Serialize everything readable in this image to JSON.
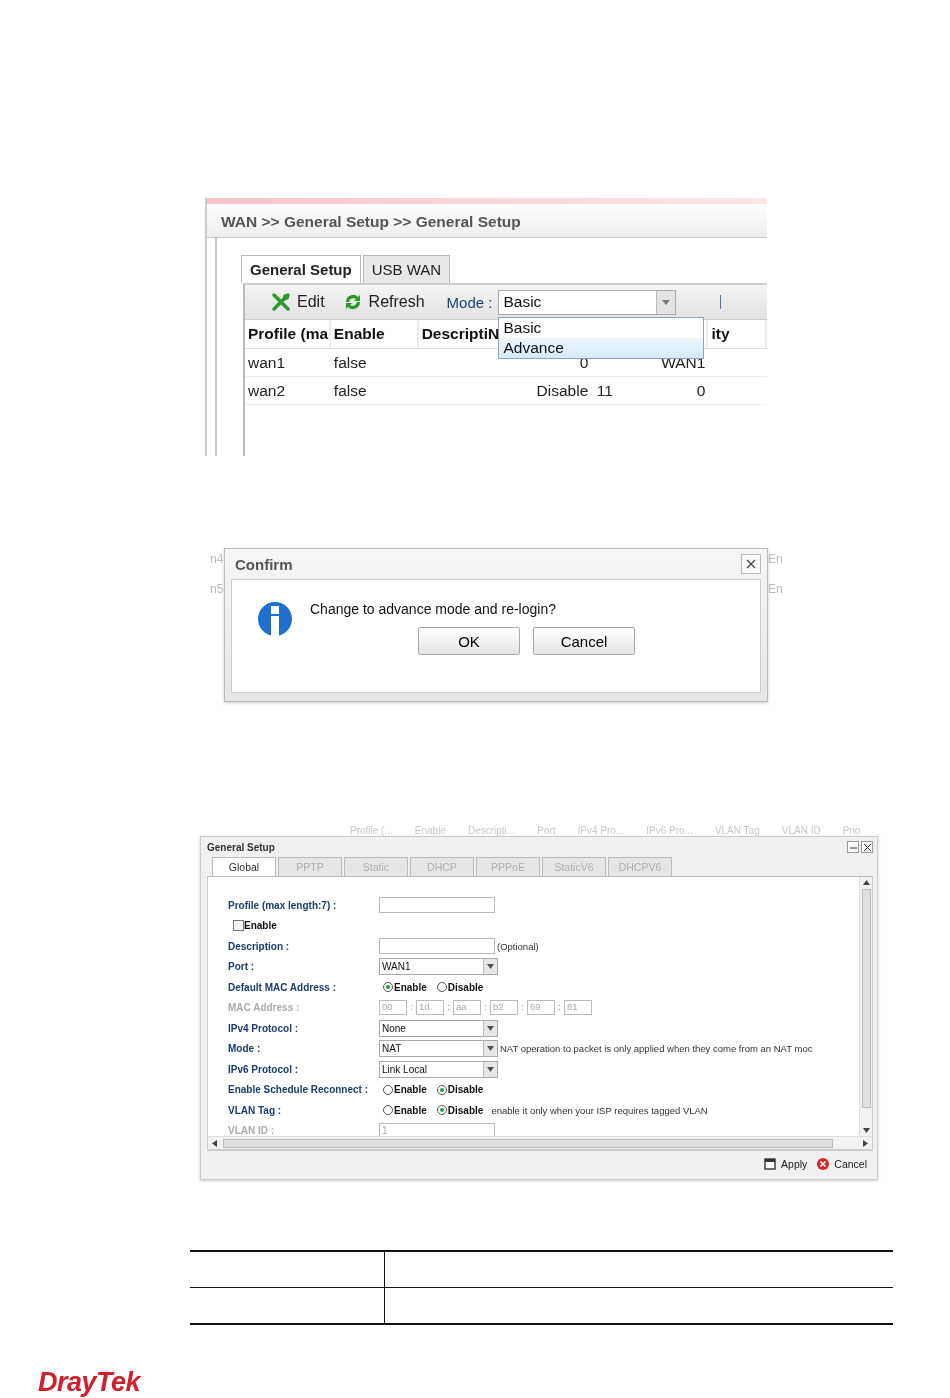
{
  "wan_general_setup": {
    "breadcrumb": "WAN >> General Setup >> General Setup",
    "tabs": [
      {
        "label": "General Setup",
        "selected": true
      },
      {
        "label": "USB WAN",
        "selected": false
      }
    ],
    "toolbar": {
      "edit": "Edit",
      "refresh": "Refresh",
      "mode_label": "Mode :",
      "mode_value": "Basic"
    },
    "mode_options": [
      {
        "label": "Basic",
        "selected": false
      },
      {
        "label": "Advance",
        "selected": true
      }
    ],
    "table": {
      "columns": [
        "Profile (ma",
        "Enable",
        "DescriptiN",
        "",
        "",
        "",
        "ity"
      ],
      "rows": [
        [
          "wan1",
          "false",
          "",
          "0",
          "",
          "WAN1",
          ""
        ],
        [
          "wan2",
          "false",
          "",
          "Disable",
          "11",
          "0",
          ""
        ]
      ]
    }
  },
  "confirm_dialog": {
    "background_left": [
      "n4",
      "n5"
    ],
    "background_right": [
      "En",
      "En"
    ],
    "title": "Confirm",
    "message": "Change to advance mode and re-login?",
    "buttons": [
      "OK",
      "Cancel"
    ]
  },
  "general_setup_window": {
    "background_columns": [
      "Profile (...",
      "Enable",
      "Descripti...",
      "Port",
      "IPv4 Pro...",
      "IPv6 Pro...",
      "VLAN Tag",
      "VLAN ID",
      "Prio"
    ],
    "title": "General Setup",
    "tabs": [
      {
        "label": "Global",
        "selected": true,
        "disabled": false
      },
      {
        "label": "PPTP",
        "selected": false,
        "disabled": true
      },
      {
        "label": "Static",
        "selected": false,
        "disabled": true
      },
      {
        "label": "DHCP",
        "selected": false,
        "disabled": true
      },
      {
        "label": "PPPoE",
        "selected": false,
        "disabled": true
      },
      {
        "label": "StaticV6",
        "selected": false,
        "disabled": true
      },
      {
        "label": "DHCPV6",
        "selected": false,
        "disabled": true
      }
    ],
    "fields": [
      {
        "kind": "text",
        "label": "Profile (max length:7) :",
        "disabled": false
      },
      {
        "kind": "checkbox",
        "label": "Enable",
        "checked": false
      },
      {
        "kind": "text",
        "label": "Description :",
        "suffix": "(Optional)",
        "disabled": false
      },
      {
        "kind": "select",
        "label": "Port :",
        "value": "WAN1"
      },
      {
        "kind": "radio",
        "label": "Default MAC Address :",
        "options": [
          {
            "label": "Enable",
            "selected": true
          },
          {
            "label": "Disable",
            "selected": false
          }
        ]
      },
      {
        "kind": "mac",
        "label": "MAC Address :",
        "disabled": true,
        "parts": [
          "00",
          "1d",
          "aa",
          "b2",
          "69",
          "81"
        ]
      },
      {
        "kind": "select",
        "label": "IPv4 Protocol :",
        "value": "None"
      },
      {
        "kind": "select",
        "label": "Mode :",
        "value": "NAT",
        "note": "NAT operation to packet is only applied when they come from an NAT moc"
      },
      {
        "kind": "select",
        "label": "IPv6 Protocol :",
        "value": "Link Local"
      },
      {
        "kind": "radio",
        "label": "Enable Schedule Reconnect :",
        "options": [
          {
            "label": "Enable",
            "selected": false
          },
          {
            "label": "Disable",
            "selected": true
          }
        ]
      },
      {
        "kind": "radio",
        "label": "VLAN Tag :",
        "options": [
          {
            "label": "Enable",
            "selected": false
          },
          {
            "label": "Disable",
            "selected": true
          }
        ],
        "note": "enable it only when your ISP requires tagged VLAN"
      },
      {
        "kind": "text",
        "label": "VLAN ID :",
        "value": "1",
        "disabled": true
      }
    ],
    "buttons": [
      "Apply",
      "Cancel"
    ]
  },
  "footer": {
    "logo": "DrayTek"
  }
}
